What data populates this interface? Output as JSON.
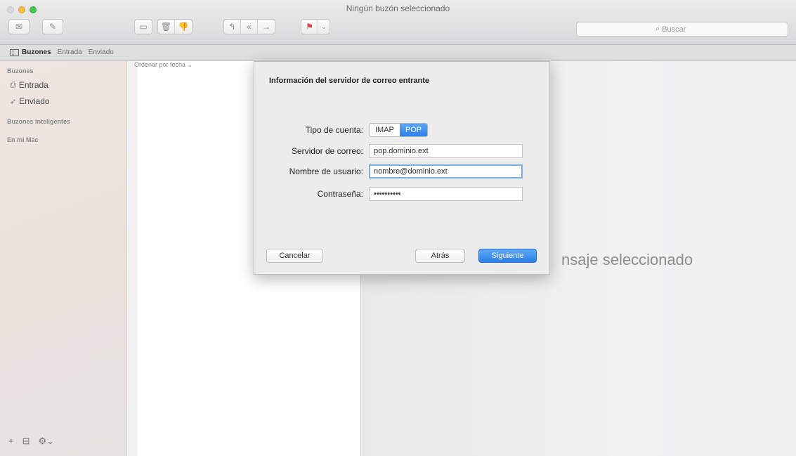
{
  "window": {
    "title": "Ningún buzón seleccionado"
  },
  "toolbar": {
    "search_placeholder": "Buscar"
  },
  "favorites": {
    "mailboxes": "Buzones",
    "inbox": "Entrada",
    "sent": "Enviado"
  },
  "sidebar": {
    "header_mailboxes": "Buzones",
    "items": [
      {
        "label": "Entrada",
        "icon": "inbox-icon"
      },
      {
        "label": "Enviado",
        "icon": "sent-icon"
      }
    ],
    "header_smart": "Buzones inteligentes",
    "header_mac": "En mi Mac"
  },
  "message_list": {
    "sort_label": "Ordenar por fecha ⌄"
  },
  "preview": {
    "empty_text": "nsaje seleccionado"
  },
  "dialog": {
    "title": "Información del servidor de correo entrante",
    "account_type_label": "Tipo de cuenta:",
    "account_type_options": [
      "IMAP",
      "POP"
    ],
    "account_type_selected": "POP",
    "server_label": "Servidor de correo:",
    "server_value": "pop.dominio.ext",
    "username_label": "Nombre de usuario:",
    "username_value": "nombre@dominio.ext",
    "password_label": "Contraseña:",
    "password_value": "••••••••••",
    "cancel_label": "Cancelar",
    "back_label": "Atrás",
    "next_label": "Siguiente"
  },
  "colors": {
    "accent": "#2c82ec",
    "focus_ring": "#7baee8"
  }
}
